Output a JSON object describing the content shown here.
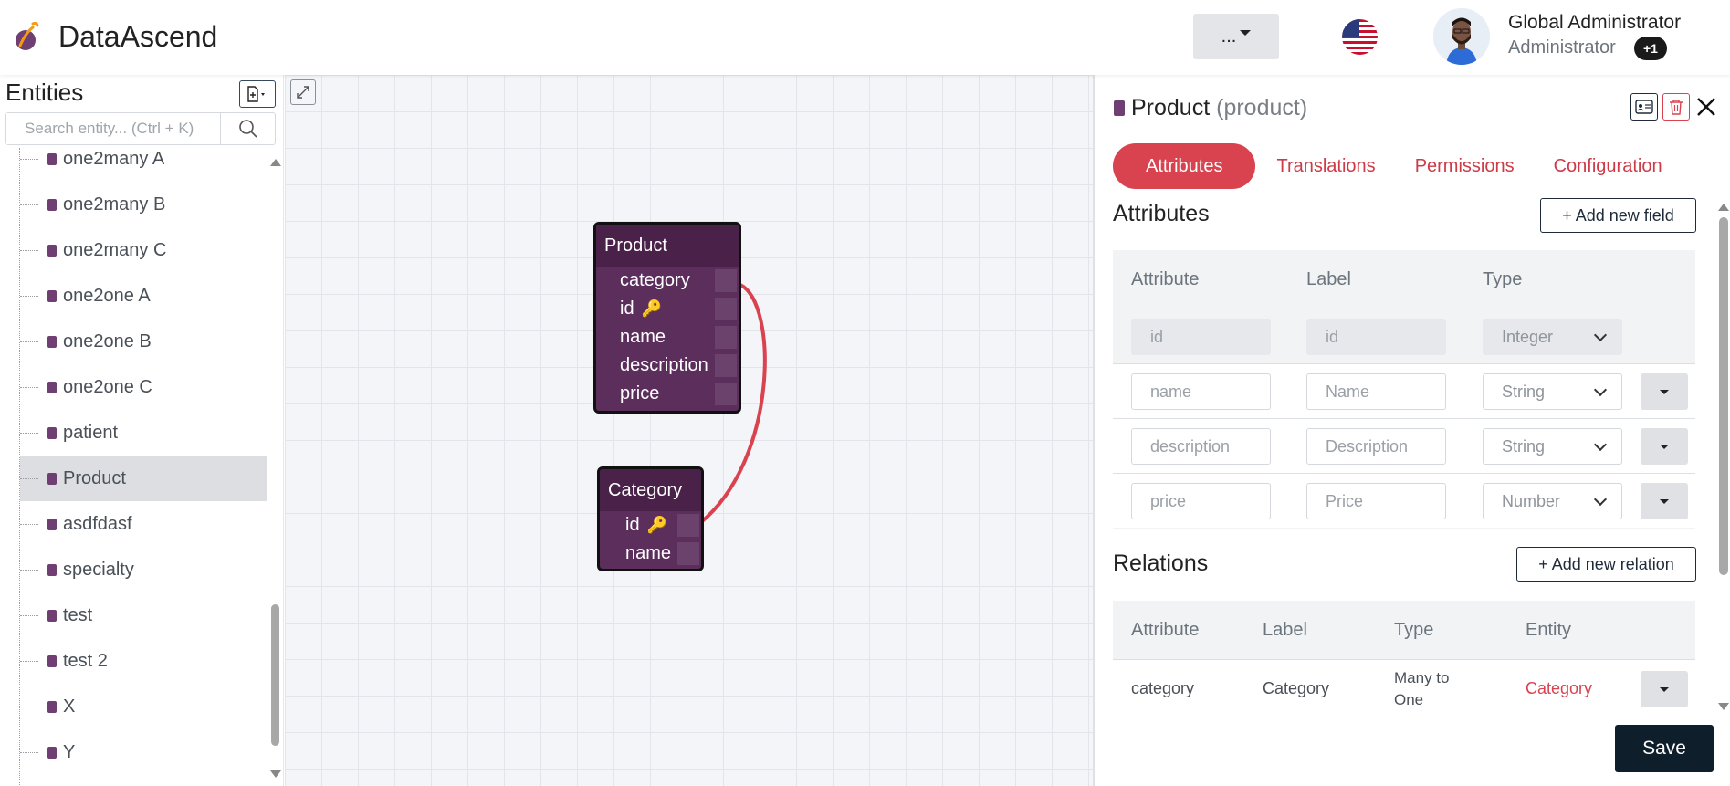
{
  "app": {
    "title": "DataAscend",
    "brand_color": "#6f3f73"
  },
  "header": {
    "menu_label": "...",
    "user_name": "Global Administrator",
    "user_role": "Administrator",
    "role_badge": "+1"
  },
  "sidebar": {
    "title": "Entities",
    "search_placeholder": "Search entity... (Ctrl + K)",
    "items": [
      {
        "label": "one2many A"
      },
      {
        "label": "one2many B"
      },
      {
        "label": "one2many C"
      },
      {
        "label": "one2one A"
      },
      {
        "label": "one2one B"
      },
      {
        "label": "one2one C"
      },
      {
        "label": "patient"
      },
      {
        "label": "Product",
        "active": true
      },
      {
        "label": "asdfdasf"
      },
      {
        "label": "specialty"
      },
      {
        "label": "test"
      },
      {
        "label": "test 2"
      },
      {
        "label": "X"
      },
      {
        "label": "Y"
      }
    ]
  },
  "canvas": {
    "product": {
      "title": "Product",
      "fields": [
        "category",
        "id",
        "name",
        "description",
        "price"
      ]
    },
    "category": {
      "title": "Category",
      "fields": [
        "id",
        "name"
      ]
    },
    "relation_color": "#d9434f"
  },
  "panel": {
    "entity_name": "Product",
    "entity_key": "(product)",
    "tabs": [
      "Attributes",
      "Translations",
      "Permissions",
      "Configuration"
    ],
    "attributes": {
      "title": "Attributes",
      "add_label": "+ Add new field",
      "headers": [
        "Attribute",
        "Label",
        "Type"
      ],
      "rows": [
        {
          "attribute": "id",
          "label": "id",
          "type": "Integer"
        },
        {
          "attribute": "name",
          "label": "Name",
          "type": "String"
        },
        {
          "attribute": "description",
          "label": "Description",
          "type": "String"
        },
        {
          "attribute": "price",
          "label": "Price",
          "type": "Number"
        }
      ]
    },
    "relations": {
      "title": "Relations",
      "add_label": "+ Add new relation",
      "headers": [
        "Attribute",
        "Label",
        "Type",
        "Entity"
      ],
      "rows": [
        {
          "attribute": "category",
          "label": "Category",
          "type": "Many to One",
          "entity": "Category"
        }
      ]
    },
    "save_label": "Save"
  }
}
